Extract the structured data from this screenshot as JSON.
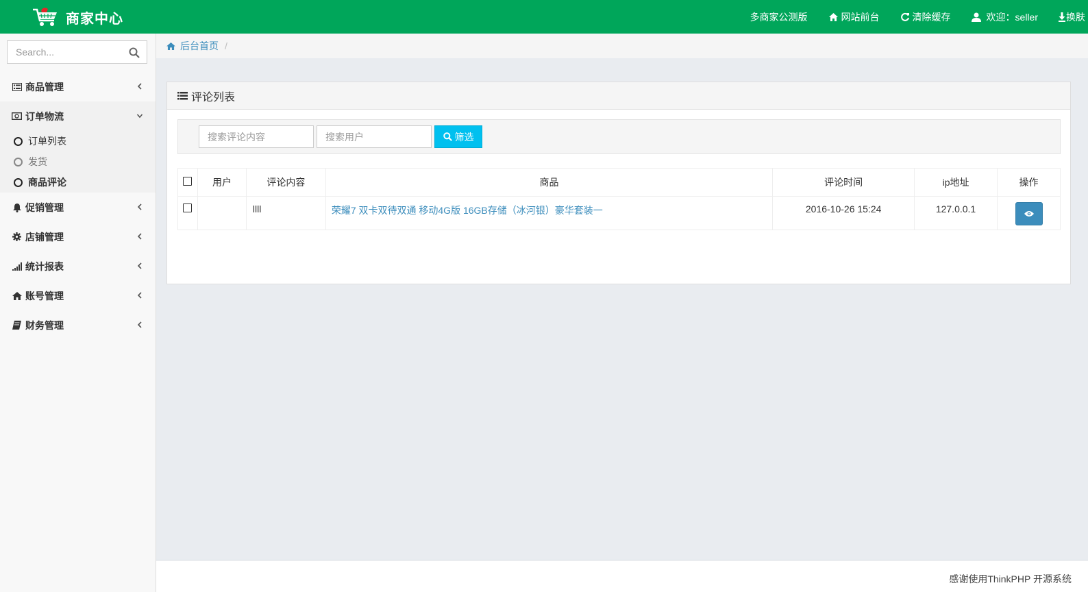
{
  "header": {
    "brand": "商家中心",
    "links": [
      {
        "label": "多商家公测版",
        "icon": "none"
      },
      {
        "label": "网站前台",
        "icon": "home-icon"
      },
      {
        "label": "清除缓存",
        "icon": "refresh-icon"
      },
      {
        "label": "欢迎：seller",
        "icon": "user-icon"
      },
      {
        "label": "换肤",
        "icon": "download-icon"
      }
    ]
  },
  "sidebar": {
    "search_placeholder": "Search...",
    "menu": [
      {
        "label": "商品管理",
        "icon": "list-alt-icon",
        "expanded": false
      },
      {
        "label": "订单物流",
        "icon": "money-icon",
        "expanded": true,
        "children": [
          {
            "label": "订单列表"
          },
          {
            "label": "发货"
          },
          {
            "label": "商品评论",
            "active": true
          }
        ]
      },
      {
        "label": "促销管理",
        "icon": "bell-icon",
        "expanded": false
      },
      {
        "label": "店铺管理",
        "icon": "cog-icon",
        "expanded": false
      },
      {
        "label": "统计报表",
        "icon": "signal-icon",
        "expanded": false
      },
      {
        "label": "账号管理",
        "icon": "home-icon",
        "expanded": false
      },
      {
        "label": "财务管理",
        "icon": "book-icon",
        "expanded": false
      }
    ]
  },
  "breadcrumb": {
    "home": "后台首页",
    "separator": "/"
  },
  "panel": {
    "title": "评论列表",
    "filter": {
      "content_placeholder": "搜索评论内容",
      "user_placeholder": "搜索用户",
      "button": "筛选"
    },
    "table": {
      "columns": [
        "用户",
        "评论内容",
        "商品",
        "评论时间",
        "ip地址",
        "操作"
      ],
      "rows": [
        {
          "user": "",
          "content": "llll",
          "goods": "荣耀7 双卡双待双通 移动4G版 16GB存储（冰河银）豪华套装一",
          "time": "2016-10-26 15:24",
          "ip": "127.0.0.1"
        }
      ]
    }
  },
  "footer": {
    "text": "感谢使用ThinkPHP 开源系统"
  },
  "colors": {
    "header_bg": "#00a65a",
    "link": "#3c8dbc",
    "filter_button": "#00c0ef",
    "view_button": "#3c8dbc"
  }
}
